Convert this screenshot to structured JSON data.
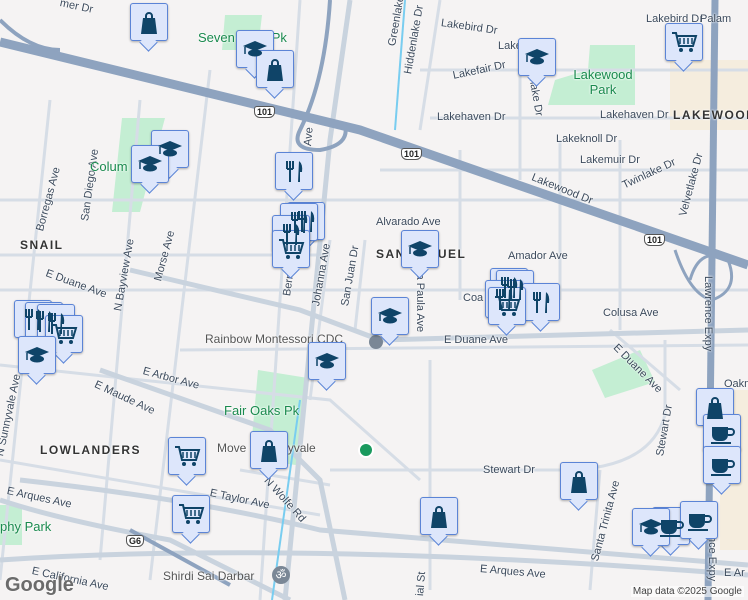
{
  "map": {
    "streets": [
      {
        "id": "b",
        "text": "B"
      },
      {
        "id": "mer",
        "text": "mer Dr"
      },
      {
        "id": "borregas",
        "text": "Borregas Ave"
      },
      {
        "id": "sandiego",
        "text": "San Diego Ave"
      },
      {
        "id": "morse",
        "text": "Morse Ave"
      },
      {
        "id": "nbayview",
        "text": "N Bayview Ave"
      },
      {
        "id": "eduane1",
        "text": "E Duane Ave"
      },
      {
        "id": "bernal",
        "text": "Bernal Ave"
      },
      {
        "id": "johanna",
        "text": "Johanna Ave"
      },
      {
        "id": "sanjuan",
        "text": "San Juan Dr"
      },
      {
        "id": "ave1",
        "text": "Ave"
      },
      {
        "id": "ave2",
        "text": "Ave"
      },
      {
        "id": "alvarado",
        "text": "Alvarado Ave"
      },
      {
        "id": "amador",
        "text": "Amador Ave"
      },
      {
        "id": "santapaula",
        "text": "Santa Paula Ave"
      },
      {
        "id": "coa",
        "text": "Coa"
      },
      {
        "id": "colusa",
        "text": "Colusa Ave"
      },
      {
        "id": "eduane2",
        "text": "E Duane Ave"
      },
      {
        "id": "eduane3",
        "text": "E Duane Ave"
      },
      {
        "id": "lakebird1",
        "text": "Lakebird Dr"
      },
      {
        "id": "lakebird2",
        "text": "Lakebird Dr"
      },
      {
        "id": "lake",
        "text": "Lake"
      },
      {
        "id": "greenlake",
        "text": "Greenlake Dr"
      },
      {
        "id": "hiddenlake",
        "text": "Hiddenlake Dr"
      },
      {
        "id": "lakefair",
        "text": "Lakefair Dr"
      },
      {
        "id": "meadowlake",
        "text": "adowlake Dr"
      },
      {
        "id": "lakehaven1",
        "text": "Lakehaven Dr"
      },
      {
        "id": "lakehaven2",
        "text": "Lakehaven Dr"
      },
      {
        "id": "lakeknoll",
        "text": "Lakeknoll Dr"
      },
      {
        "id": "lakemuir",
        "text": "Lakemuir Dr"
      },
      {
        "id": "lakewood",
        "text": "Lakewood Dr"
      },
      {
        "id": "twinlake",
        "text": "Twinlake Dr"
      },
      {
        "id": "velvetlake",
        "text": "Velvetlake Dr"
      },
      {
        "id": "lawrence1",
        "text": "Lawrence Expy"
      },
      {
        "id": "lawrence2",
        "text": "Lawrence Expy"
      },
      {
        "id": "oakm",
        "text": "Oakm"
      },
      {
        "id": "earbor",
        "text": "E Arbor Ave"
      },
      {
        "id": "emaude",
        "text": "E Maude Ave"
      },
      {
        "id": "nsunnyvale",
        "text": "N Sunnyvale Ave"
      },
      {
        "id": "earques1",
        "text": "E Arques Ave"
      },
      {
        "id": "etaylor",
        "text": "E Taylor Ave"
      },
      {
        "id": "nwolfe",
        "text": "N Wolfe Rd"
      },
      {
        "id": "ecalifornia",
        "text": "E California Ave"
      },
      {
        "id": "stewart",
        "text": "Stewart Dr"
      },
      {
        "id": "stewart2",
        "text": "Stewart Dr"
      },
      {
        "id": "santatrinita",
        "text": "Santa Trinita Ave"
      },
      {
        "id": "earques2",
        "text": "E Arques Ave"
      },
      {
        "id": "earques3",
        "text": "E Ar"
      },
      {
        "id": "commercial",
        "text": "ial St"
      },
      {
        "id": "dr",
        "text": "Dr"
      },
      {
        "id": "palam",
        "text": "Palam"
      }
    ],
    "parks": [
      {
        "id": "seven",
        "text": "Seven Seas Pk"
      },
      {
        "id": "colum",
        "text": "Colum"
      },
      {
        "id": "lakewoodpark",
        "text": "Lakewood Park"
      },
      {
        "id": "fairoaks",
        "text": "Fair Oaks Pk"
      },
      {
        "id": "murphy",
        "text": "phy Park"
      }
    ],
    "neighborhoods": [
      {
        "id": "snail",
        "text": "SNAIL"
      },
      {
        "id": "sanmiguel",
        "text": "SAN MIGUEL"
      },
      {
        "id": "lakewoodhood",
        "text": "LAKEWOOD"
      },
      {
        "id": "lowlanders",
        "text": "LOWLANDERS"
      }
    ],
    "pois": [
      {
        "id": "rainbow",
        "text": "Rainbow Montessori CDC"
      },
      {
        "id": "moveit",
        "text": "Move It Sunnyvale"
      },
      {
        "id": "shirdi",
        "text": "Shirdi Sai Darbar"
      }
    ],
    "shields": {
      "us101": "101",
      "g6": "G6"
    },
    "branding": {
      "logo": "Google",
      "attribution": "Map data ©2025 Google"
    }
  },
  "colors": {
    "marker_fill": "#dde6fb",
    "marker_border": "#5b84d6",
    "icon": "#0f4468",
    "highway": "#8ea3bf",
    "park": "#c4eed3",
    "park_label": "#1a8a4e"
  }
}
